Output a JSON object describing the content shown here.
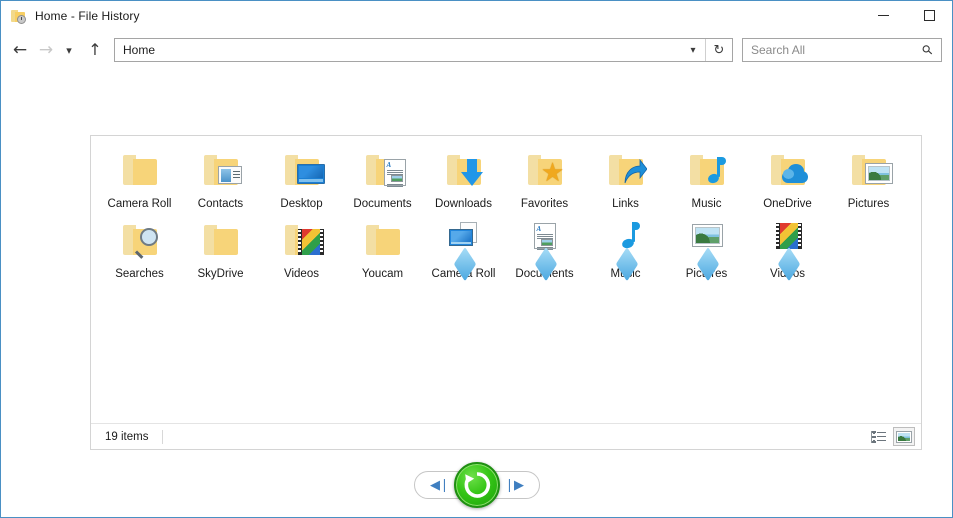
{
  "window": {
    "title": "Home - File History",
    "title_icon": "folder-history-icon",
    "buttons": {
      "minimize": "minimize-icon",
      "maximize": "maximize-icon"
    }
  },
  "navbar": {
    "back": "back-arrow-icon",
    "forward": "forward-arrow-icon",
    "recent": "chevron-down-icon",
    "up": "up-arrow-icon",
    "address_value": "Home",
    "address_chevron": "chevron-down-icon",
    "refresh": "refresh-icon",
    "search_placeholder": "Search All",
    "search_icon": "search-icon"
  },
  "content": {
    "rows": [
      [
        {
          "label": "Camera Roll",
          "icon": "folder-icon",
          "kind": "folder",
          "badge": "none"
        },
        {
          "label": "Contacts",
          "icon": "folder-contacts-icon",
          "kind": "folder",
          "badge": "contact"
        },
        {
          "label": "Desktop",
          "icon": "folder-desktop-icon",
          "kind": "folder",
          "badge": "monitor"
        },
        {
          "label": "Documents",
          "icon": "folder-documents-icon",
          "kind": "folder",
          "badge": "doc"
        },
        {
          "label": "Downloads",
          "icon": "folder-downloads-icon",
          "kind": "folder",
          "badge": "down"
        },
        {
          "label": "Favorites",
          "icon": "folder-favorites-icon",
          "kind": "folder",
          "badge": "star"
        },
        {
          "label": "Links",
          "icon": "folder-links-icon",
          "kind": "folder",
          "badge": "link"
        },
        {
          "label": "Music",
          "icon": "folder-music-icon",
          "kind": "folder",
          "badge": "music"
        },
        {
          "label": "OneDrive",
          "icon": "folder-onedrive-icon",
          "kind": "folder",
          "badge": "cloud"
        },
        {
          "label": "Pictures",
          "icon": "folder-pictures-icon",
          "kind": "folder",
          "badge": "photo"
        }
      ],
      [
        {
          "label": "Searches",
          "icon": "folder-searches-icon",
          "kind": "folder",
          "badge": "search"
        },
        {
          "label": "SkyDrive",
          "icon": "folder-icon",
          "kind": "folder",
          "badge": "none"
        },
        {
          "label": "Videos",
          "icon": "folder-videos-icon",
          "kind": "folder",
          "badge": "film"
        },
        {
          "label": "Youcam",
          "icon": "folder-icon",
          "kind": "folder",
          "badge": "none"
        },
        {
          "label": "Camera Roll",
          "icon": "library-camera-roll-icon",
          "kind": "library",
          "badge": "cam"
        },
        {
          "label": "Documents",
          "icon": "library-documents-icon",
          "kind": "library",
          "badge": "doc"
        },
        {
          "label": "Music",
          "icon": "library-music-icon",
          "kind": "library",
          "badge": "music"
        },
        {
          "label": "Pictures",
          "icon": "library-pictures-icon",
          "kind": "library",
          "badge": "photo"
        },
        {
          "label": "Videos",
          "icon": "library-videos-icon",
          "kind": "library",
          "badge": "film"
        }
      ]
    ]
  },
  "statusbar": {
    "item_count": "19 items",
    "view_details": "details-view-icon",
    "view_large_icons": "large-icons-view-icon"
  },
  "bottom_controls": {
    "previous": "previous-version-icon",
    "previous_glyph": "◀❘",
    "restore": "restore-icon",
    "next": "next-version-icon",
    "next_glyph": "❘▶"
  },
  "colors": {
    "window_border": "#4a90c4",
    "folder_light": "#f3dfa4",
    "folder_main": "#f7d479",
    "accent_blue": "#1f8fd8",
    "restore_green": "#35c516",
    "text": "#1b1b1b"
  }
}
